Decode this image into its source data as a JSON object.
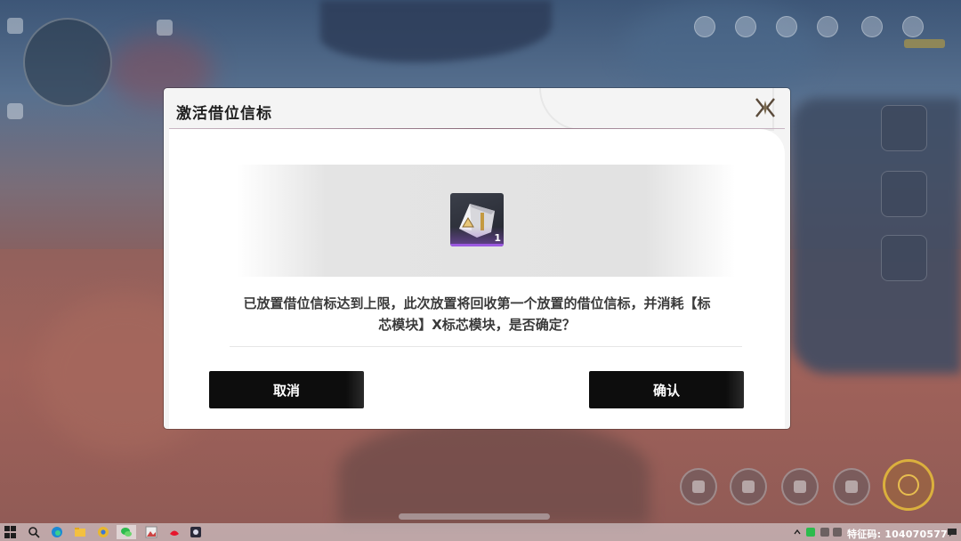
{
  "dialog": {
    "title": "激活借位信标",
    "item": {
      "count": "1",
      "rarity_color": "#9b59e0"
    },
    "message_line1": "已放置借位信标达到上限，此次放置将回收第一个放置的借位信标，并消耗【标",
    "message_line2": "芯模块】X标芯模块，是否确定？",
    "cancel_label": "取消",
    "confirm_label": "确认"
  },
  "taskbar": {
    "icons": [
      "windows-start-icon",
      "search-icon",
      "edge-browser-icon",
      "file-explorer-icon",
      "chrome-icon",
      "wechat-icon",
      "image-viewer-icon",
      "weibo-icon",
      "game-icon"
    ],
    "tray_text": "特征码: 104070577"
  },
  "colors": {
    "dialog_bg": "#f4f4f4",
    "button_bg": "#0d0d0d",
    "accent": "#9b59e0"
  }
}
